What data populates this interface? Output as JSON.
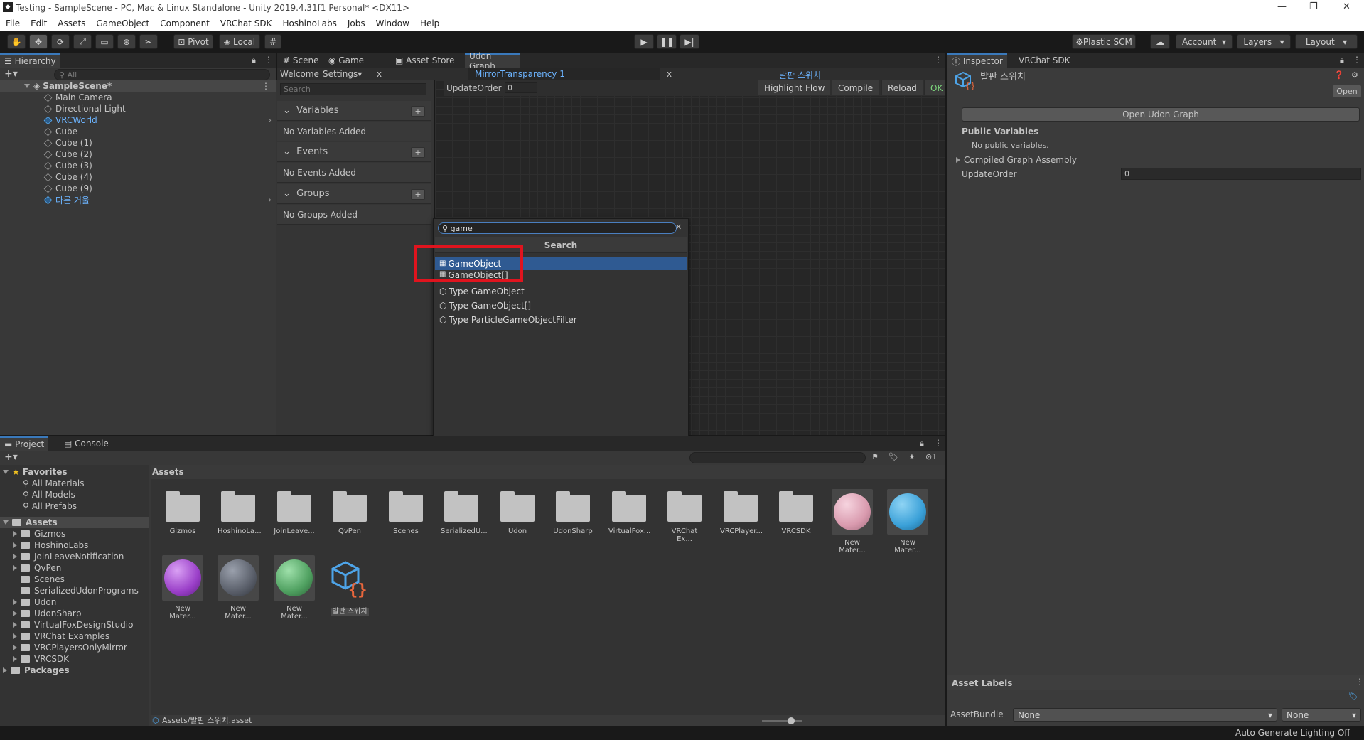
{
  "window": {
    "title": "Testing - SampleScene - PC, Mac & Linux Standalone - Unity 2019.4.31f1 Personal* <DX11>",
    "controls": [
      "—",
      "❐",
      "✕"
    ]
  },
  "menu": [
    "File",
    "Edit",
    "Assets",
    "GameObject",
    "Component",
    "VRChat SDK",
    "HoshinoLabs",
    "Jobs",
    "Window",
    "Help"
  ],
  "toolbar": {
    "pivot_label": "Pivot",
    "local_label": "Local",
    "plastic_label": "Plastic SCM",
    "account_label": "Account",
    "layers_label": "Layers",
    "layout_label": "Layout"
  },
  "hierarchy": {
    "tab_label": "Hierarchy",
    "search_placeholder": "All",
    "scene_name": "SampleScene*",
    "items": [
      "Main Camera",
      "Directional Light",
      "VRCWorld",
      "Cube",
      "Cube (1)",
      "Cube (2)",
      "Cube (3)",
      "Cube (4)",
      "Cube (9)",
      "다른 거울"
    ]
  },
  "center_tabs": [
    "Scene",
    "Game",
    "Asset Store",
    "Udon Graph"
  ],
  "udon": {
    "welcome_label": "Welcome",
    "settings_label": "Settings",
    "close_x": "x",
    "graph_tab1": "MirrorTransparency 1",
    "graph_tab2": "발판 스위치",
    "search_placeholder": "Search",
    "variables_label": "Variables",
    "no_variables": "No Variables Added",
    "events_label": "Events",
    "no_events": "No Events Added",
    "groups_label": "Groups",
    "no_groups": "No Groups Added",
    "update_order_label": "UpdateOrder",
    "update_order_value": "0",
    "highlight_flow": "Highlight Flow",
    "compile": "Compile",
    "reload": "Reload",
    "ok": "OK"
  },
  "search_popup": {
    "query": "game",
    "header": "Search",
    "results": [
      "GameObject",
      "GameObject[]",
      "Type GameObject",
      "Type GameObject[]",
      "Type ParticleGameObjectFilter"
    ]
  },
  "inspector": {
    "tab_label": "Inspector",
    "sdk_tab_label": "VRChat SDK",
    "asset_name": "발판 스위치",
    "open_label": "Open",
    "open_graph_label": "Open Udon Graph",
    "public_vars_label": "Public Variables",
    "no_public_vars": "No public variables.",
    "compiled_label": "Compiled Graph Assembly",
    "update_order_label": "UpdateOrder",
    "update_order_value": "0",
    "asset_labels": "Asset Labels",
    "assetbundle_label": "AssetBundle",
    "assetbundle_value": "None",
    "variant_value": "None"
  },
  "project": {
    "tab_project": "Project",
    "tab_console": "Console",
    "favorites_label": "Favorites",
    "favorites": [
      "All Materials",
      "All Models",
      "All Prefabs"
    ],
    "assets_label": "Assets",
    "folders": [
      "Gizmos",
      "HoshinoLabs",
      "JoinLeaveNotification",
      "QvPen",
      "Scenes",
      "SerializedUdonPrograms",
      "Udon",
      "UdonSharp",
      "VirtualFoxDesignStudio",
      "VRChat Examples",
      "VRCPlayersOnlyMirror",
      "VRCSDK"
    ],
    "packages_label": "Packages",
    "breadcrumb": "Assets",
    "grid_folders": [
      "Gizmos",
      "HoshinoLa...",
      "JoinLeave...",
      "QvPen",
      "Scenes",
      "SerializedU...",
      "Udon",
      "UdonSharp",
      "VirtualFox...",
      "VRChat Ex...",
      "VRCPlayer...",
      "VRCSDK"
    ],
    "grid_materials_row1": [
      "New Mater...",
      "New Mater..."
    ],
    "grid_materials_row2": [
      "New Mater...",
      "New Mater...",
      "New Mater..."
    ],
    "udon_asset_label": "발판 스위치",
    "hidden_count": "1",
    "path_label": "Assets/발판 스위치.asset"
  },
  "status": {
    "text": "Auto Generate Lighting Off"
  },
  "colors": {
    "accent_blue": "#3a79bb",
    "highlight_red": "#e0141e",
    "selected_row": "#2f5a92",
    "mat_pink": "#d99aae",
    "mat_blue": "#3aa0d8",
    "mat_purple": "#9a3fc8",
    "mat_gray": "#5a5f6a",
    "mat_green": "#4fa060",
    "udon_blue": "#4ea4e8",
    "udon_orange": "#e8663c"
  }
}
